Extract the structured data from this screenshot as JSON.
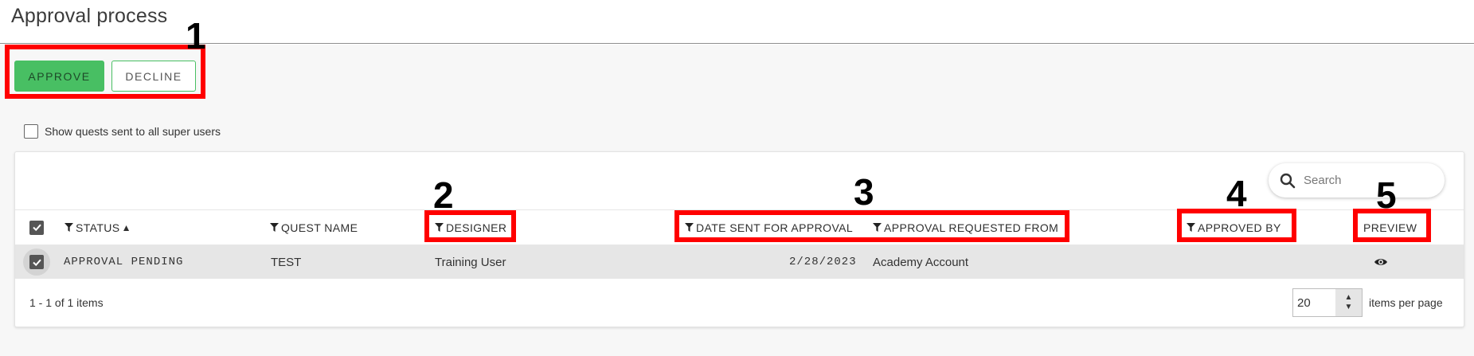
{
  "page": {
    "title": "Approval process"
  },
  "toolbar": {
    "approve_label": "APPROVE",
    "decline_label": "DECLINE"
  },
  "filters": {
    "show_all_label": "Show quests sent to all super users",
    "show_all_checked": false
  },
  "search": {
    "placeholder": "Search"
  },
  "grid": {
    "columns": [
      {
        "key": "status",
        "label": "STATUS",
        "sort": "▲"
      },
      {
        "key": "quest_name",
        "label": "QUEST NAME"
      },
      {
        "key": "designer",
        "label": "DESIGNER"
      },
      {
        "key": "date_sent",
        "label": "DATE SENT FOR APPROVAL"
      },
      {
        "key": "requested_from",
        "label": "APPROVAL REQUESTED FROM"
      },
      {
        "key": "approved_by",
        "label": "APPROVED BY"
      },
      {
        "key": "preview",
        "label": "PREVIEW"
      }
    ],
    "rows": [
      {
        "checked": true,
        "status": "APPROVAL PENDING",
        "quest_name": "TEST",
        "designer": "Training User",
        "date_sent": "2/28/2023",
        "requested_from": "Academy Account",
        "approved_by": "",
        "preview_icon": "eye-icon"
      }
    ]
  },
  "pager": {
    "info": "1 - 1 of 1 items",
    "per_page_value": "20",
    "per_page_label": "items per page"
  },
  "annotations": [
    "1",
    "2",
    "3",
    "4",
    "5"
  ],
  "colors": {
    "approve_green": "#48bf63",
    "annotation_red": "#ff0000",
    "row_highlight": "#e6e6e6"
  }
}
